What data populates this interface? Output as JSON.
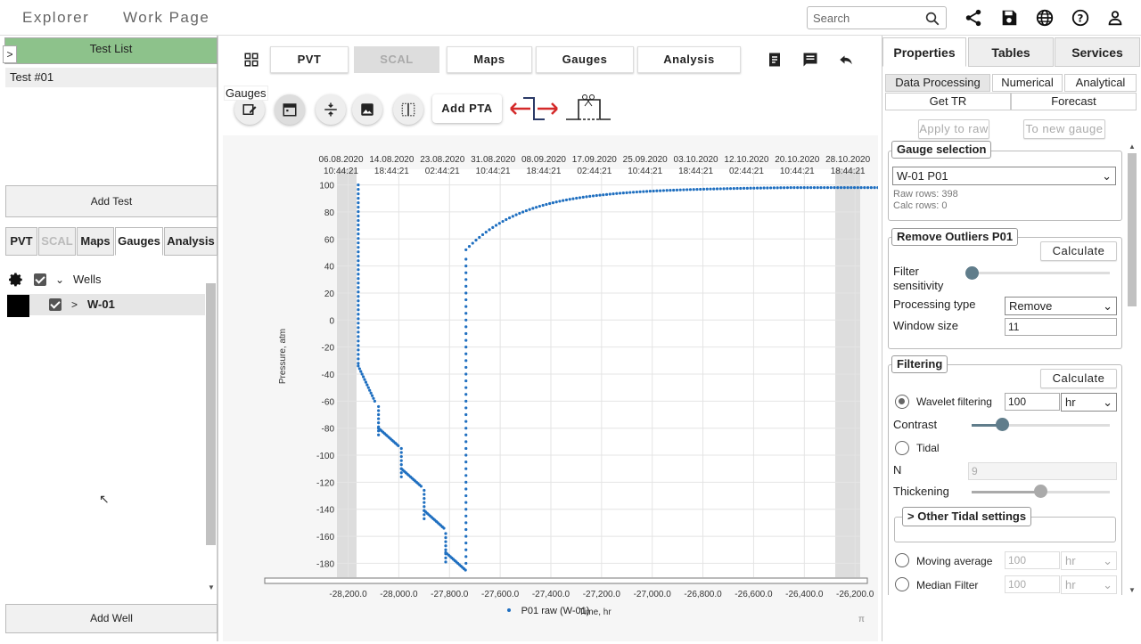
{
  "nav": {
    "explorer": "Explorer",
    "workpage": "Work Page"
  },
  "search": {
    "placeholder": "Search"
  },
  "icons": [
    "share-icon",
    "save-icon",
    "globe-icon",
    "help-icon",
    "user-icon"
  ],
  "left": {
    "testlist_header": "Test List",
    "tests": [
      "Test #01"
    ],
    "add_test": "Add Test",
    "tabs": [
      "PVT",
      "SCAL",
      "Maps",
      "Gauges",
      "Analysis"
    ],
    "tree_root": "Wells",
    "well": "W-01",
    "add_well": "Add Well"
  },
  "center": {
    "tabs": [
      "PVT",
      "SCAL",
      "Maps",
      "Gauges",
      "Analysis"
    ],
    "tooltip": "Gauges",
    "add_pta": "Add PTA"
  },
  "chart_data": {
    "type": "scatter",
    "xlabel": "Time, hr",
    "ylabel": "Pressure, atm",
    "x_ticks": [
      -28200,
      -28000,
      -27800,
      -27600,
      -27400,
      -27200,
      -27000,
      -26800,
      -26600,
      -26400,
      -26200
    ],
    "x_tick_labels": [
      "-28,200.0",
      "-28,000.0",
      "-27,800.0",
      "-27,600.0",
      "-27,400.0",
      "-27,200.0",
      "-27,000.0",
      "-26,800.0",
      "-26,600.0",
      "-26,400.0",
      "-26,200.0"
    ],
    "y_ticks": [
      100,
      80,
      60,
      40,
      20,
      0,
      -20,
      -40,
      -60,
      -80,
      -100,
      -120,
      -140,
      -160,
      -180
    ],
    "xlim": [
      -28230,
      -26190
    ],
    "ylim": [
      -185,
      105
    ],
    "top_dates": [
      [
        "06.08.2020",
        "10:44:21"
      ],
      [
        "14.08.2020",
        "18:44:21"
      ],
      [
        "23.08.2020",
        "02:44:21"
      ],
      [
        "31.08.2020",
        "10:44:21"
      ],
      [
        "08.09.2020",
        "18:44:21"
      ],
      [
        "17.09.2020",
        "02:44:21"
      ],
      [
        "25.09.2020",
        "10:44:21"
      ],
      [
        "03.10.2020",
        "18:44:21"
      ],
      [
        "12.10.2020",
        "02:44:21"
      ],
      [
        "20.10.2020",
        "10:44:21"
      ],
      [
        "28.10.2020",
        "18:44:21"
      ]
    ],
    "series": [
      {
        "name": "P01 raw (W-01)",
        "color": "#1f6fc0"
      }
    ],
    "legend_position": "bottom-center"
  },
  "right": {
    "tabs": [
      "Properties",
      "Tables",
      "Services"
    ],
    "subtabs": [
      "Data Processing",
      "Numerical",
      "Analytical"
    ],
    "subtabs2": [
      "Get TR",
      "Forecast"
    ],
    "apply_raw": "Apply to raw",
    "new_gauge": "To new gauge",
    "gauge_selection": "Gauge selection",
    "gauge_value": "W-01 P01",
    "raw_rows": "Raw rows: 398",
    "calc_rows": "Calc rows: 0",
    "remove_outliers": "Remove Outliers P01",
    "calculate": "Calculate",
    "filter_sensitivity": "Filter sensitivity",
    "processing_type_label": "Processing type",
    "processing_type": "Remove",
    "window_size_label": "Window size",
    "window_size": "11",
    "filtering": "Filtering",
    "wavelet": "Wavelet filtering",
    "wavelet_value": "100",
    "wavelet_unit": "hr",
    "contrast": "Contrast",
    "tidal": "Tidal",
    "n_label": "N",
    "n_value": "9",
    "thickening": "Thickening",
    "other_tidal": "Other Tidal settings",
    "moving_avg": "Moving average",
    "moving_avg_value": "100",
    "moving_avg_unit": "hr",
    "median": "Median Filter",
    "median_value": "100",
    "median_unit": "hr"
  }
}
